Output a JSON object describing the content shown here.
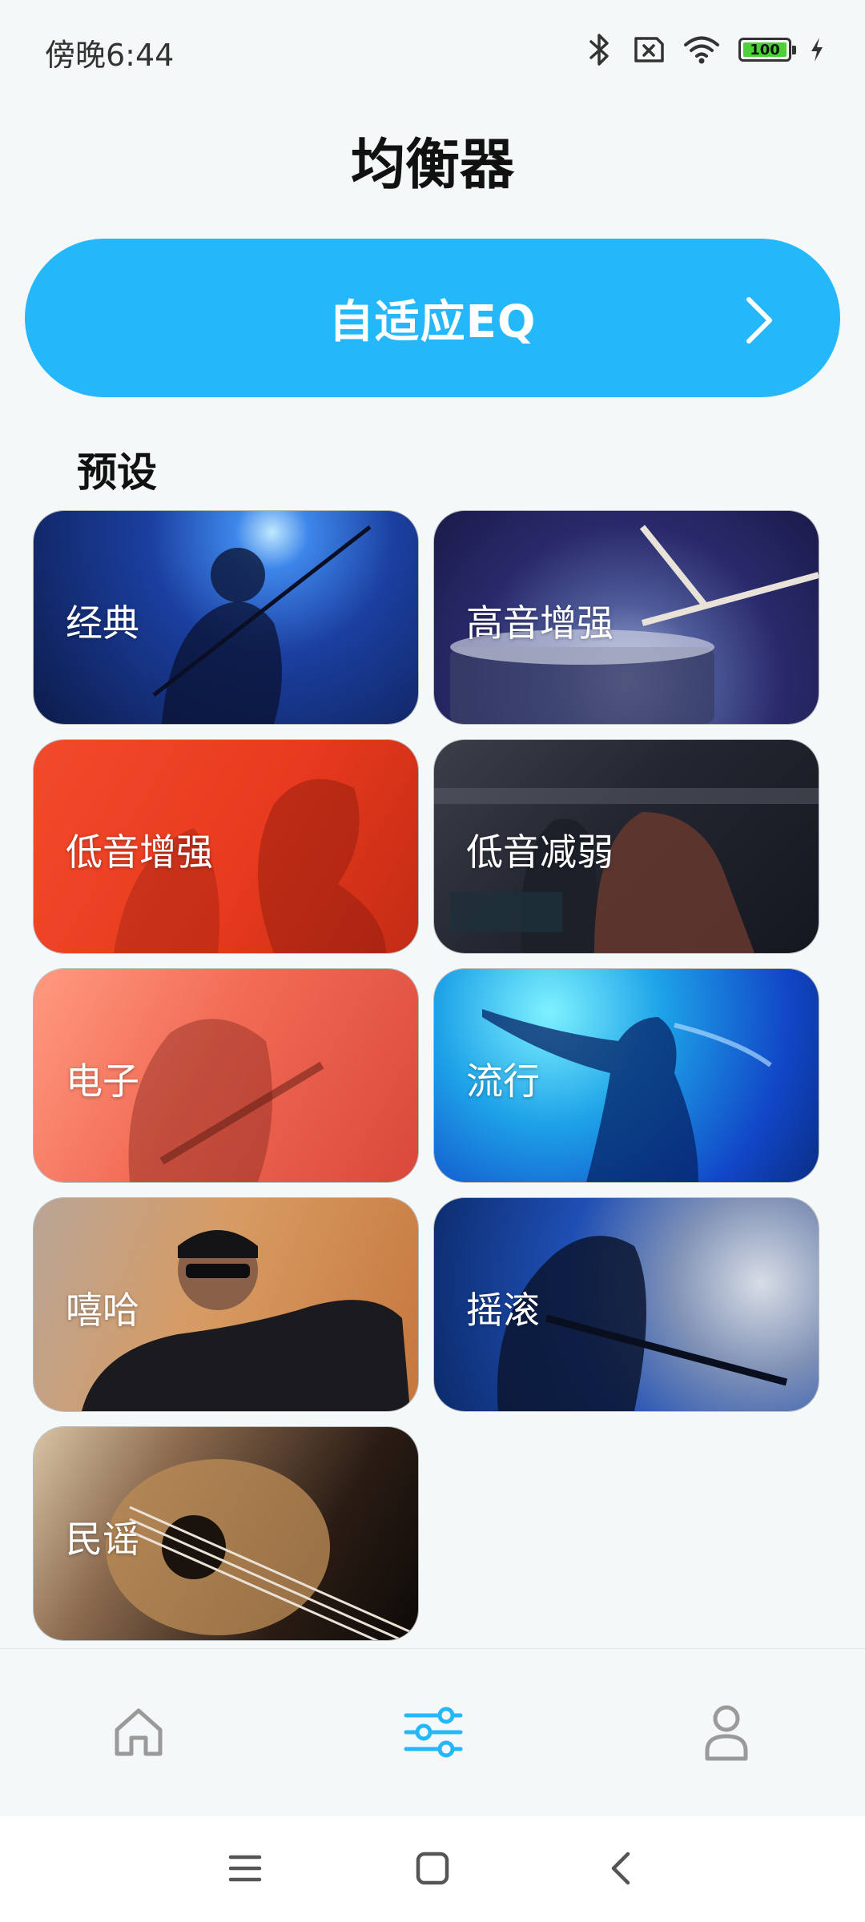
{
  "status_bar": {
    "time": "傍晚6:44",
    "battery": "100"
  },
  "page": {
    "title": "均衡器"
  },
  "adaptive_eq": {
    "label": "自适应EQ"
  },
  "presets": {
    "title": "预设",
    "items": [
      {
        "label": "经典"
      },
      {
        "label": "高音增强"
      },
      {
        "label": "低音增强"
      },
      {
        "label": "低音减弱"
      },
      {
        "label": "电子"
      },
      {
        "label": "流行"
      },
      {
        "label": "嘻哈"
      },
      {
        "label": "摇滚"
      },
      {
        "label": "民谣"
      }
    ]
  },
  "colors": {
    "accent": "#24b8fb",
    "nav_inactive": "#9a9a9a"
  },
  "icons": {
    "bottom_nav": [
      "home-icon",
      "equalizer-sliders-icon",
      "user-icon"
    ],
    "system_nav": [
      "menu-icon",
      "home-square-icon",
      "back-icon"
    ]
  }
}
